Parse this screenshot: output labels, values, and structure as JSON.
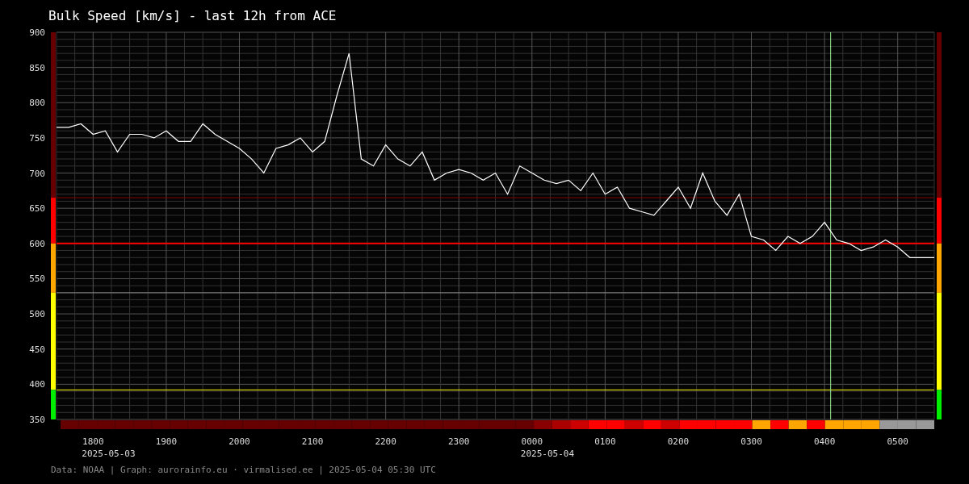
{
  "chart_data": {
    "type": "line",
    "title": "Bulk Speed [km/s] - last 12h from ACE",
    "grid": true,
    "ylim": [
      350,
      900
    ],
    "yticks": [
      350,
      400,
      450,
      500,
      550,
      600,
      650,
      700,
      750,
      800,
      850,
      900
    ],
    "categories": [
      null,
      null,
      null,
      "1800",
      null,
      null,
      null,
      null,
      null,
      "1900",
      null,
      null,
      null,
      null,
      null,
      "2000",
      null,
      null,
      null,
      null,
      null,
      "2100",
      null,
      null,
      null,
      null,
      null,
      "2200",
      null,
      null,
      null,
      null,
      null,
      "2300",
      null,
      null,
      null,
      null,
      null,
      "0000",
      null,
      null,
      null,
      null,
      null,
      "0100",
      null,
      null,
      null,
      null,
      null,
      "0200",
      null,
      null,
      null,
      null,
      null,
      "0300",
      null,
      null,
      null,
      null,
      null,
      "0400",
      null,
      null,
      null,
      null,
      null,
      "0500",
      null,
      null,
      null
    ],
    "series": [
      {
        "color": "#ffffff",
        "values": [
          765,
          765,
          770,
          755,
          760,
          730,
          755,
          755,
          750,
          760,
          745,
          745,
          770,
          755,
          745,
          735,
          720,
          700,
          735,
          740,
          750,
          730,
          745,
          810,
          870,
          720,
          710,
          740,
          720,
          710,
          730,
          690,
          700,
          705,
          700,
          690,
          700,
          670,
          710,
          700,
          690,
          685,
          690,
          675,
          700,
          670,
          680,
          650,
          645,
          640,
          660,
          680,
          650,
          700,
          660,
          640,
          670,
          610,
          605,
          590,
          610,
          600,
          610,
          630,
          605,
          600,
          590,
          595,
          605,
          595,
          580,
          580,
          580
        ]
      }
    ],
    "ref_lines": [
      {
        "axis": "y",
        "value": 665,
        "color": "#880000"
      },
      {
        "axis": "y",
        "value": 600,
        "color": "#ff0000"
      },
      {
        "axis": "y",
        "value": 530,
        "color": "#888888"
      },
      {
        "axis": "y",
        "value": 392,
        "color": "#ffff00"
      }
    ]
  },
  "dates": [
    "2025-05-03",
    "2025-05-04"
  ],
  "scale_bar": [
    {
      "color": "#660000"
    },
    {
      "color": "#ff0000"
    },
    {
      "color": "#ffa500"
    },
    {
      "color": "#ffff00"
    },
    {
      "color": "#00ee00"
    }
  ],
  "status_strip": [
    {
      "color": "#660000"
    },
    {
      "color": "#660000"
    },
    {
      "color": "#660000"
    },
    {
      "color": "#660000"
    },
    {
      "color": "#660000"
    },
    {
      "color": "#660000"
    },
    {
      "color": "#660000"
    },
    {
      "color": "#660000"
    },
    {
      "color": "#660000"
    },
    {
      "color": "#660000"
    },
    {
      "color": "#660000"
    },
    {
      "color": "#660000"
    },
    {
      "color": "#660000"
    },
    {
      "color": "#660000"
    },
    {
      "color": "#660000"
    },
    {
      "color": "#660000"
    },
    {
      "color": "#660000"
    },
    {
      "color": "#660000"
    },
    {
      "color": "#660000"
    },
    {
      "color": "#660000"
    },
    {
      "color": "#660000"
    },
    {
      "color": "#660000"
    },
    {
      "color": "#660000"
    },
    {
      "color": "#660000"
    },
    {
      "color": "#660000"
    },
    {
      "color": "#660000"
    },
    {
      "color": "#880000"
    },
    {
      "color": "#aa0000"
    },
    {
      "color": "#cc0000"
    },
    {
      "color": "#ff0000"
    },
    {
      "color": "#ff0000"
    },
    {
      "color": "#cc0000"
    },
    {
      "color": "#ff0000"
    },
    {
      "color": "#cc0000"
    },
    {
      "color": "#ff0000"
    },
    {
      "color": "#ff0000"
    },
    {
      "color": "#ff0000"
    },
    {
      "color": "#ff0000"
    },
    {
      "color": "#ffa500"
    },
    {
      "color": "#ff0000"
    },
    {
      "color": "#ffa500"
    },
    {
      "color": "#ff0000"
    },
    {
      "color": "#ffa500"
    },
    {
      "color": "#ffa500"
    },
    {
      "color": "#ffa500"
    },
    {
      "color": "#999999"
    },
    {
      "color": "#999999"
    },
    {
      "color": "#999999"
    }
  ],
  "footer": "Data: NOAA | Graph: aurorainfo.eu · virmalised.ee | 2025-05-04 05:30 UTC"
}
